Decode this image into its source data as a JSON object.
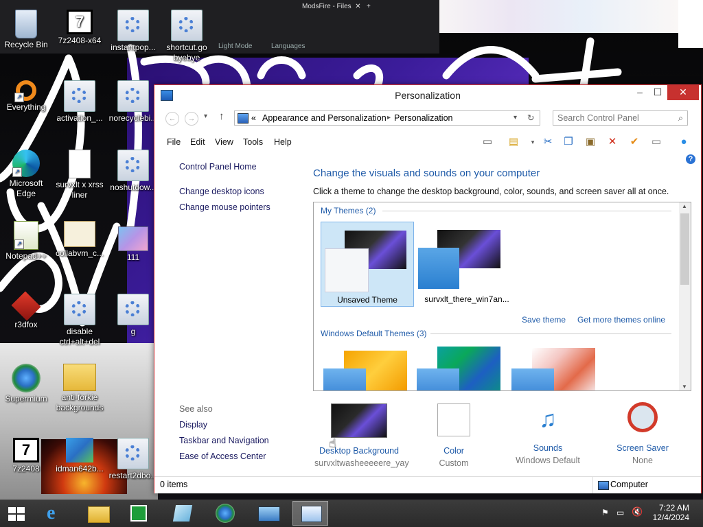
{
  "desktop": {
    "browser_tabs": [
      "ModsFire - Files"
    ],
    "browser_bar_items": [
      "Light Mode",
      "Languages"
    ],
    "icons": [
      {
        "label": "Recycle Bin",
        "icon": "recycle-bin"
      },
      {
        "label": "7z2408-x64",
        "icon": "7zip-installer"
      },
      {
        "label": "instantpop...",
        "icon": "settings-gear"
      },
      {
        "label": "shortcut.go byebye",
        "icon": "settings-gear"
      },
      {
        "label": "Everything",
        "icon": "everything-search"
      },
      {
        "label": "activation_...",
        "icon": "settings-gear"
      },
      {
        "label": "norecyclebi...",
        "icon": "settings-gear"
      },
      {
        "label": "Microsoft Edge",
        "icon": "edge"
      },
      {
        "label": "survxlt x xrss liner",
        "icon": "text-file"
      },
      {
        "label": "noshutdow...",
        "icon": "settings-gear"
      },
      {
        "label": "Notepad++",
        "icon": "notepad-plus-plus"
      },
      {
        "label": "collabvm_c...",
        "icon": "certificate"
      },
      {
        "label": "111",
        "icon": "image"
      },
      {
        "label": "r3dfox",
        "icon": "r3dfox"
      },
      {
        "label": "disable ctrl+alt+del",
        "icon": "settings-gear"
      },
      {
        "label": "g",
        "icon": "settings-gear"
      },
      {
        "label": "Supermium",
        "icon": "supermium"
      },
      {
        "label": "anti-forkie backgrounds",
        "icon": "zip-folder"
      },
      {
        "label": "7z2408",
        "icon": "7zip-installer"
      },
      {
        "label": "idman642b...",
        "icon": "idm-installer"
      },
      {
        "label": "restart2dbo...",
        "icon": "settings-gear"
      }
    ]
  },
  "window": {
    "title": "Personalization",
    "address": {
      "prefix": "«",
      "crumbs": [
        "Appearance and Personalization",
        "Personalization"
      ]
    },
    "search_placeholder": "Search Control Panel",
    "menu": [
      "File",
      "Edit",
      "View",
      "Tools",
      "Help"
    ],
    "left_links": [
      "Control Panel Home",
      "Change desktop icons",
      "Change mouse pointers"
    ],
    "see_also": {
      "title": "See also",
      "links": [
        "Display",
        "Taskbar and Navigation",
        "Ease of Access Center"
      ]
    },
    "heading": "Change the visuals and sounds on your computer",
    "subheading": "Click a theme to change the desktop background, color, sounds, and screen saver all at once.",
    "my_themes": {
      "label": "My Themes (2)",
      "items": [
        {
          "name": "Unsaved Theme",
          "selected": true
        },
        {
          "name": "survxlt_there_win7an...",
          "selected": false
        }
      ],
      "save_link": "Save theme",
      "more_link": "Get more themes online"
    },
    "default_themes": {
      "label": "Windows Default Themes (3)"
    },
    "bottom": [
      {
        "title": "Desktop Background",
        "value": "survxltwasheeeeere_yay"
      },
      {
        "title": "Color",
        "value": "Custom"
      },
      {
        "title": "Sounds",
        "value": "Windows Default"
      },
      {
        "title": "Screen Saver",
        "value": "None"
      }
    ],
    "status": {
      "items": "0 items",
      "location": "Computer"
    }
  },
  "taskbar": {
    "time": "7:22 AM",
    "date": "12/4/2024"
  },
  "colors": {
    "link": "#1e5aa8",
    "close": "#c7312f",
    "selection": "#cde6f7"
  }
}
